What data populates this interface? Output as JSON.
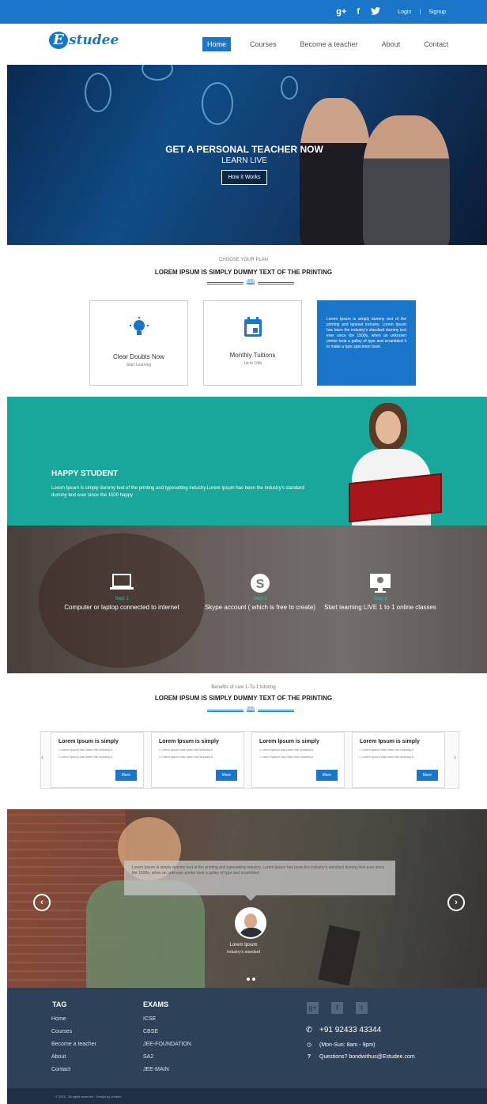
{
  "topbar": {
    "social": [
      "g+",
      "f",
      "t"
    ],
    "login_label": "Login",
    "separator": "|",
    "signup_label": "Signup"
  },
  "header": {
    "logo_initial": "E",
    "logo_text": "studee",
    "nav": [
      "Home",
      "Courses",
      "Become a teacher",
      "About",
      "Contact"
    ],
    "active_nav": "Home"
  },
  "hero": {
    "title": "GET A PERSONAL TEACHER NOW",
    "subtitle": "LEARN LIVE",
    "button": "How it Works"
  },
  "plan": {
    "kicker": "CHOOSE YOUR PLAN",
    "heading": "LOREM IPSUM IS SIMPLY DUMMY TEXT OF THE PRINTING",
    "cards": [
      {
        "icon": "lightbulb-icon",
        "title": "Clear Doubts Now",
        "sub": "Start Learning"
      },
      {
        "icon": "calendar-icon",
        "title": "Monthly Tuitions",
        "sub": "1st to 10th"
      }
    ],
    "blue_text": "Lorem Ipsum is simply dummy text of the printing and typeset industry. Lorem Ipsum has been the industry's standard dummy text ever since the 1500s, when an unknown printer took a galley of type and scrambled it to make a type specimen book."
  },
  "happy": {
    "title": "HAPPY STUDENT",
    "text": "Lorem Ipsum is simply dummy text of the printing and typesetting industry.Lorem Ipsum has been the industry's standard dummy text ever since the 1500 happy"
  },
  "steps": [
    {
      "icon": "laptop-icon",
      "label": "Step 1",
      "desc": "Computer or laptop connected to internet"
    },
    {
      "icon": "skype-icon",
      "label": "Step 2",
      "desc": "Skype account ( which is free to create)"
    },
    {
      "icon": "monitor-icon",
      "label": "Step 3",
      "desc": "Start learning LIVE 1 to 1 online classes"
    }
  ],
  "benefits": {
    "kicker": "Benefits of Live 1-To-1 tutoring",
    "heading": "LOREM IPSUM IS SIMPLY DUMMY TEXT OF THE PRINTING",
    "cards": [
      {
        "title": "Lorem Ipsum is simply",
        "items": [
          "Lorem Ipsum has been the industry's",
          "Lorem Ipsum has been the industry's"
        ],
        "button": "More"
      },
      {
        "title": "Lorem Ipsum is simply",
        "items": [
          "Lorem Ipsum has been the industry's",
          "Lorem Ipsum has been the industry's"
        ],
        "button": "More"
      },
      {
        "title": "Lorem Ipsum is simply",
        "items": [
          "Lorem Ipsum has been the industry's",
          "Lorem Ipsum has been the industry's"
        ],
        "button": "More"
      },
      {
        "title": "Lorem Ipsum is simply",
        "items": [
          "Lorem Ipsum has been the industry's",
          "Lorem Ipsum has been the industry's"
        ],
        "button": "More"
      }
    ]
  },
  "testimonial": {
    "quote": "Lorem Ipsum is simply dummy text of the printing and typesetting industry. Lorem Ipsum has been the industry's standard dummy text ever since the 1500s, when an unknown printer took a galley of type and scrambled",
    "name": "Lorem Ipsum",
    "role": "Industry's standard"
  },
  "footer": {
    "tag_heading": "TAG",
    "tag_links": [
      "Home",
      "Courses",
      "Become a teacher",
      "About",
      "Contact"
    ],
    "exams_heading": "EXAMS",
    "exam_links": [
      "ICSE",
      "CBSE",
      "JEE-FOUNDATION",
      "SA2",
      "JEE-MAIN"
    ],
    "phone": "+91 92433 43344",
    "hours": "(Mon-Sun: 8am - 9pm)",
    "email": "Questions? bondwithus@Estudee.com",
    "copyright": "© 2015 . All rights reserved . Design by creatso"
  },
  "colors": {
    "brand": "#1976c9",
    "teal": "#19a79b",
    "footer": "#2d4259"
  }
}
